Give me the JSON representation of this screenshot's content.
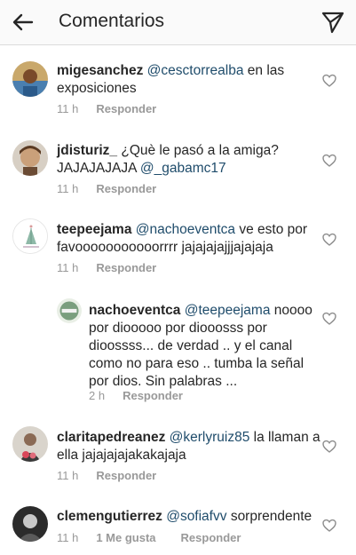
{
  "header": {
    "title": "Comentarios",
    "back_icon": "arrow-left-icon",
    "send_icon": "paper-plane-icon"
  },
  "comments": [
    {
      "username": "migesanchez",
      "mention": "@cesctorrealba",
      "body": "en las exposiciones",
      "time": "11 h",
      "reply_label": "Responder"
    },
    {
      "username": "jdisturiz_",
      "body_pre": "¿Què le pasó a la amiga? JAJAJAJAJA",
      "mention": "@_gabamc17",
      "time": "11 h",
      "reply_label": "Responder"
    },
    {
      "username": "teepeejama",
      "mention": "@nachoeventca",
      "body": "ve esto por favooooooooooorrrr jajajajajjjajajaja",
      "time": "11 h",
      "reply_label": "Responder"
    },
    {
      "username": "nachoeventca",
      "mention": "@teepeejama",
      "body": "noooo por diooooo por diooosss por dioossss... de verdad .. y el canal como no para eso .. tumba la señal por dios. Sin palabras ...",
      "time": "2 h",
      "reply_label": "Responder"
    },
    {
      "username": "claritapedreanez",
      "mention": "@kerlyruiz85",
      "body": "la llaman a ella jajajajajakakajaja",
      "time": "11 h",
      "reply_label": "Responder"
    },
    {
      "username": "clemengutierrez",
      "mention": "@sofiafvv",
      "body": "sorprendente",
      "time": "11 h",
      "likes": "1 Me gusta",
      "reply_label": "Responder"
    }
  ]
}
